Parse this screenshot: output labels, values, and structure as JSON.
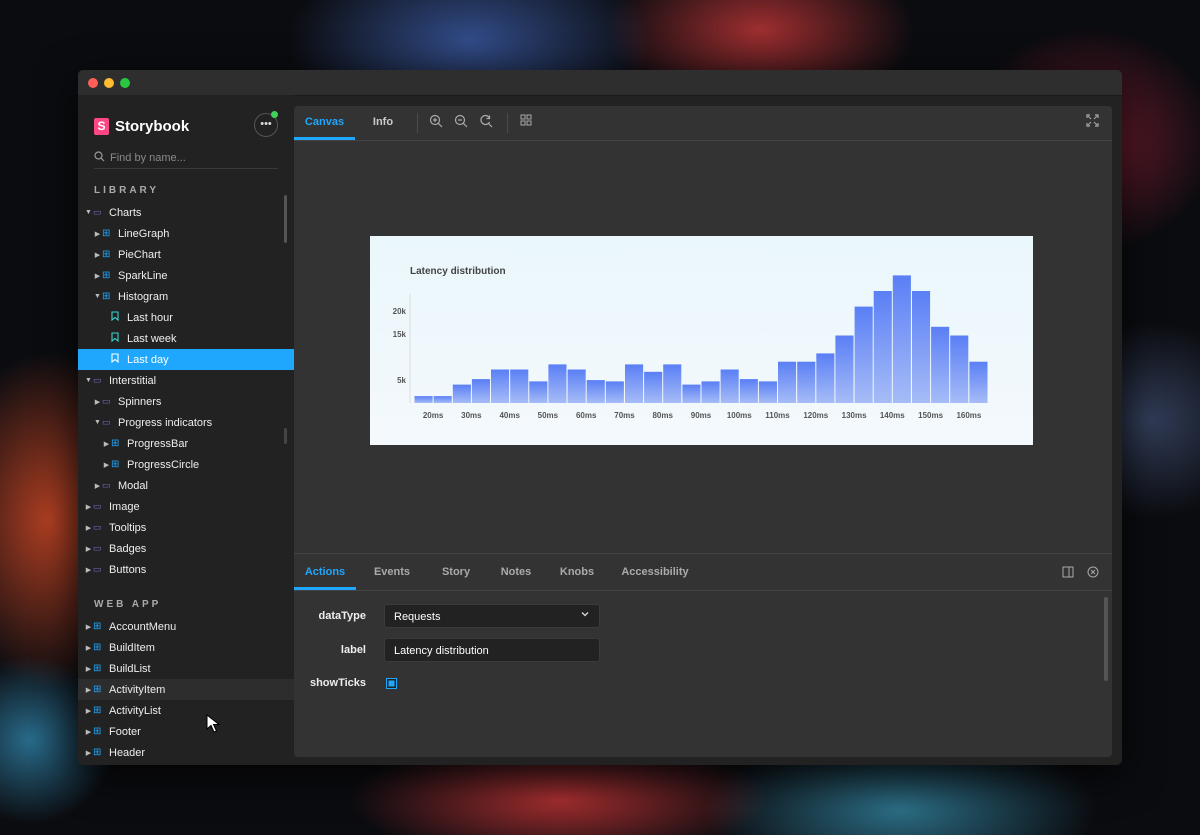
{
  "sidebar": {
    "brand": "Storybook",
    "menu_glyph": "•••",
    "search_placeholder": "Find by name...",
    "library_label": "LIBRARY",
    "webapp_label": "WEB APP",
    "library_items": [
      {
        "label": "Charts",
        "depth": 0,
        "kind": "folder",
        "expanded": true
      },
      {
        "label": "LineGraph",
        "depth": 1,
        "kind": "component",
        "expanded": false
      },
      {
        "label": "PieChart",
        "depth": 1,
        "kind": "component",
        "expanded": false
      },
      {
        "label": "SparkLine",
        "depth": 1,
        "kind": "component",
        "expanded": false
      },
      {
        "label": "Histogram",
        "depth": 1,
        "kind": "component",
        "expanded": true
      },
      {
        "label": "Last hour",
        "depth": 2,
        "kind": "story"
      },
      {
        "label": "Last week",
        "depth": 2,
        "kind": "story"
      },
      {
        "label": "Last day",
        "depth": 2,
        "kind": "story",
        "selected": true
      },
      {
        "label": "Interstitial",
        "depth": 0,
        "kind": "folder",
        "expanded": true
      },
      {
        "label": "Spinners",
        "depth": 1,
        "kind": "folder",
        "expanded": false
      },
      {
        "label": "Progress indicators",
        "depth": 1,
        "kind": "folder",
        "expanded": true
      },
      {
        "label": "ProgressBar",
        "depth": 2,
        "kind": "component",
        "expanded": false
      },
      {
        "label": "ProgressCircle",
        "depth": 2,
        "kind": "component",
        "expanded": false
      },
      {
        "label": "Modal",
        "depth": 1,
        "kind": "folder",
        "expanded": false
      },
      {
        "label": "Image",
        "depth": 0,
        "kind": "folder",
        "expanded": false
      },
      {
        "label": "Tooltips",
        "depth": 0,
        "kind": "folder",
        "expanded": false
      },
      {
        "label": "Badges",
        "depth": 0,
        "kind": "folder",
        "expanded": false
      },
      {
        "label": "Buttons",
        "depth": 0,
        "kind": "folder",
        "expanded": false
      }
    ],
    "webapp_items": [
      {
        "label": "AccountMenu",
        "depth": 0,
        "kind": "component",
        "expanded": false
      },
      {
        "label": "BuildItem",
        "depth": 0,
        "kind": "component",
        "expanded": false
      },
      {
        "label": "BuildList",
        "depth": 0,
        "kind": "component",
        "expanded": false
      },
      {
        "label": "ActivityItem",
        "depth": 0,
        "kind": "component",
        "expanded": false,
        "hovered": true
      },
      {
        "label": "ActivityList",
        "depth": 0,
        "kind": "component",
        "expanded": false
      },
      {
        "label": "Footer",
        "depth": 0,
        "kind": "component",
        "expanded": false
      },
      {
        "label": "Header",
        "depth": 0,
        "kind": "component",
        "expanded": false
      }
    ]
  },
  "toolbar": {
    "tab_canvas": "Canvas",
    "tab_info": "Info"
  },
  "addons": {
    "tabs": [
      "Actions",
      "Events",
      "Story",
      "Notes",
      "Knobs",
      "Accessibility"
    ],
    "active_tab": "Actions",
    "knobs": {
      "dataType_label": "dataType",
      "dataType_value": "Requests",
      "label_label": "label",
      "label_value": "Latency distribution",
      "showTicks_label": "showTicks",
      "showTicks_checked": true
    }
  },
  "colors": {
    "accent": "#1ea7fd",
    "brand": "#ff4785",
    "bar_top": "#5a7ff5",
    "bar_bottom": "#a6bcf7"
  },
  "chart_data": {
    "type": "bar",
    "title": "Latency distribution",
    "xlabel": "",
    "ylabel": "",
    "ylim": [
      0,
      22000
    ],
    "yticks": [
      5000,
      15000,
      20000
    ],
    "ytick_labels": [
      "5k",
      "15k",
      "20k"
    ],
    "xtick_labels": [
      "20ms",
      "30ms",
      "40ms",
      "50ms",
      "60ms",
      "70ms",
      "80ms",
      "90ms",
      "100ms",
      "110ms",
      "120ms",
      "130ms",
      "140ms",
      "150ms",
      "160ms"
    ],
    "values": [
      1500,
      1500,
      4000,
      5200,
      7300,
      7300,
      4700,
      8400,
      7300,
      5000,
      4700,
      8400,
      6800,
      8400,
      4000,
      4700,
      7300,
      5200,
      4700,
      9000,
      9000,
      10800,
      14700,
      21000,
      24400,
      27800,
      24400,
      16600,
      14700,
      9000
    ]
  }
}
